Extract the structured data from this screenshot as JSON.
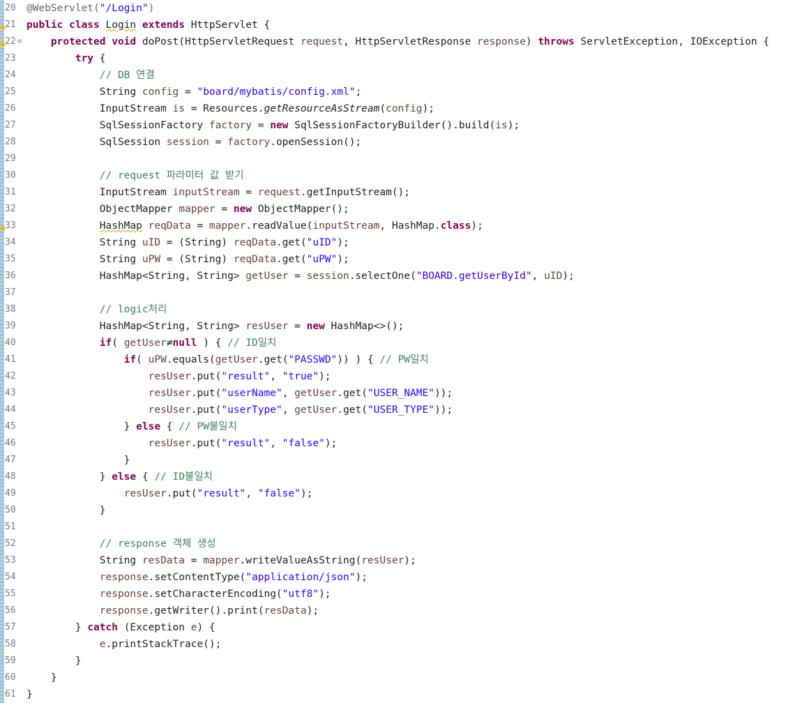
{
  "editor": {
    "lines": [
      {
        "num": "20",
        "tokens": [
          {
            "t": "@WebServlet(",
            "c": "ann"
          },
          {
            "t": "\"/Login\"",
            "c": "str"
          },
          {
            "t": ")",
            "c": "ann"
          }
        ]
      },
      {
        "num": "21",
        "marker": "warning",
        "tokens": [
          {
            "t": "public class ",
            "c": "kw"
          },
          {
            "t": "Login",
            "c": "squig"
          },
          {
            "t": " "
          },
          {
            "t": "extends",
            "c": "kw"
          },
          {
            "t": " HttpServlet {"
          }
        ]
      },
      {
        "num": "22",
        "marker": "warning",
        "fold": "⊖",
        "tokens": [
          {
            "t": "    "
          },
          {
            "t": "protected void",
            "c": "kw"
          },
          {
            "t": " doPost(HttpServletRequest "
          },
          {
            "t": "request",
            "c": "fld"
          },
          {
            "t": ", HttpServletResponse "
          },
          {
            "t": "response",
            "c": "fld"
          },
          {
            "t": ") "
          },
          {
            "t": "throws",
            "c": "kw"
          },
          {
            "t": " ServletException, IOException {"
          }
        ]
      },
      {
        "num": "23",
        "tokens": [
          {
            "t": "        "
          },
          {
            "t": "try",
            "c": "kw"
          },
          {
            "t": " {"
          }
        ]
      },
      {
        "num": "24",
        "tokens": [
          {
            "t": "            "
          },
          {
            "t": "// DB 연결",
            "c": "cm"
          }
        ]
      },
      {
        "num": "25",
        "tokens": [
          {
            "t": "            String "
          },
          {
            "t": "config",
            "c": "fld"
          },
          {
            "t": " = "
          },
          {
            "t": "\"board/mybatis/config.xml\"",
            "c": "str"
          },
          {
            "t": ";"
          }
        ]
      },
      {
        "num": "26",
        "tokens": [
          {
            "t": "            InputStream "
          },
          {
            "t": "is",
            "c": "fld"
          },
          {
            "t": " = Resources."
          },
          {
            "t": "getResourceAsStream",
            "c": "st"
          },
          {
            "t": "("
          },
          {
            "t": "config",
            "c": "fld"
          },
          {
            "t": ");"
          }
        ]
      },
      {
        "num": "27",
        "tokens": [
          {
            "t": "            SqlSessionFactory "
          },
          {
            "t": "factory",
            "c": "fld"
          },
          {
            "t": " = "
          },
          {
            "t": "new",
            "c": "kw"
          },
          {
            "t": " SqlSessionFactoryBuilder().build("
          },
          {
            "t": "is",
            "c": "fld"
          },
          {
            "t": ");"
          }
        ]
      },
      {
        "num": "28",
        "tokens": [
          {
            "t": "            SqlSession "
          },
          {
            "t": "session",
            "c": "fld"
          },
          {
            "t": " = "
          },
          {
            "t": "factory",
            "c": "fld"
          },
          {
            "t": ".openSession();"
          }
        ]
      },
      {
        "num": "29",
        "tokens": []
      },
      {
        "num": "30",
        "tokens": [
          {
            "t": "            "
          },
          {
            "t": "// request 파라미터 값 받기",
            "c": "cm"
          }
        ]
      },
      {
        "num": "31",
        "tokens": [
          {
            "t": "            InputStream "
          },
          {
            "t": "inputStream",
            "c": "fld"
          },
          {
            "t": " = "
          },
          {
            "t": "request",
            "c": "fld"
          },
          {
            "t": ".getInputStream();"
          }
        ]
      },
      {
        "num": "32",
        "tokens": [
          {
            "t": "            ObjectMapper "
          },
          {
            "t": "mapper",
            "c": "fld"
          },
          {
            "t": " = "
          },
          {
            "t": "new",
            "c": "kw"
          },
          {
            "t": " ObjectMapper();"
          }
        ]
      },
      {
        "num": "33",
        "marker": "warning",
        "tokens": [
          {
            "t": "            "
          },
          {
            "t": "HashMap",
            "c": "squig"
          },
          {
            "t": " "
          },
          {
            "t": "reqData",
            "c": "fld"
          },
          {
            "t": " = "
          },
          {
            "t": "mapper",
            "c": "fld"
          },
          {
            "t": ".readValue("
          },
          {
            "t": "inputStream",
            "c": "fld"
          },
          {
            "t": ", HashMap."
          },
          {
            "t": "class",
            "c": "kw"
          },
          {
            "t": ");"
          }
        ]
      },
      {
        "num": "34",
        "tokens": [
          {
            "t": "            String "
          },
          {
            "t": "uID",
            "c": "fld"
          },
          {
            "t": " = (String) "
          },
          {
            "t": "reqData",
            "c": "fld"
          },
          {
            "t": ".get("
          },
          {
            "t": "\"uID\"",
            "c": "str"
          },
          {
            "t": ");"
          }
        ]
      },
      {
        "num": "35",
        "tokens": [
          {
            "t": "            String "
          },
          {
            "t": "uPW",
            "c": "fld"
          },
          {
            "t": " = (String) "
          },
          {
            "t": "reqData",
            "c": "fld"
          },
          {
            "t": ".get("
          },
          {
            "t": "\"uPW\"",
            "c": "str"
          },
          {
            "t": ");"
          }
        ]
      },
      {
        "num": "36",
        "tokens": [
          {
            "t": "            HashMap<String, String> "
          },
          {
            "t": "getUser",
            "c": "fld"
          },
          {
            "t": " = "
          },
          {
            "t": "session",
            "c": "fld"
          },
          {
            "t": ".selectOne("
          },
          {
            "t": "\"BOARD.getUserById\"",
            "c": "str"
          },
          {
            "t": ", "
          },
          {
            "t": "uID",
            "c": "fld"
          },
          {
            "t": ");"
          }
        ]
      },
      {
        "num": "37",
        "tokens": []
      },
      {
        "num": "38",
        "tokens": [
          {
            "t": "            "
          },
          {
            "t": "// logic처리",
            "c": "cm"
          }
        ]
      },
      {
        "num": "39",
        "tokens": [
          {
            "t": "            HashMap<String, String> "
          },
          {
            "t": "resUser",
            "c": "fld"
          },
          {
            "t": " = "
          },
          {
            "t": "new",
            "c": "kw"
          },
          {
            "t": " HashMap<>();"
          }
        ]
      },
      {
        "num": "40",
        "tokens": [
          {
            "t": "            "
          },
          {
            "t": "if",
            "c": "kw"
          },
          {
            "t": "( "
          },
          {
            "t": "getUser",
            "c": "fld"
          },
          {
            "t": "≠"
          },
          {
            "t": "null",
            "c": "kw"
          },
          {
            "t": " ) { "
          },
          {
            "t": "// ID일치",
            "c": "cm"
          }
        ]
      },
      {
        "num": "41",
        "tokens": [
          {
            "t": "                "
          },
          {
            "t": "if",
            "c": "kw"
          },
          {
            "t": "( "
          },
          {
            "t": "uPW",
            "c": "fld"
          },
          {
            "t": ".equals("
          },
          {
            "t": "getUser",
            "c": "fld"
          },
          {
            "t": ".get("
          },
          {
            "t": "\"PASSWD\"",
            "c": "str"
          },
          {
            "t": ")) ) { "
          },
          {
            "t": "// PW일치",
            "c": "cm"
          }
        ]
      },
      {
        "num": "42",
        "tokens": [
          {
            "t": "                    "
          },
          {
            "t": "resUser",
            "c": "fld"
          },
          {
            "t": ".put("
          },
          {
            "t": "\"result\"",
            "c": "str"
          },
          {
            "t": ", "
          },
          {
            "t": "\"true\"",
            "c": "str"
          },
          {
            "t": ");"
          }
        ]
      },
      {
        "num": "43",
        "tokens": [
          {
            "t": "                    "
          },
          {
            "t": "resUser",
            "c": "fld"
          },
          {
            "t": ".put("
          },
          {
            "t": "\"userName\"",
            "c": "str"
          },
          {
            "t": ", "
          },
          {
            "t": "getUser",
            "c": "fld"
          },
          {
            "t": ".get("
          },
          {
            "t": "\"USER_NAME\"",
            "c": "str"
          },
          {
            "t": "));"
          }
        ]
      },
      {
        "num": "44",
        "tokens": [
          {
            "t": "                    "
          },
          {
            "t": "resUser",
            "c": "fld"
          },
          {
            "t": ".put("
          },
          {
            "t": "\"userType\"",
            "c": "str"
          },
          {
            "t": ", "
          },
          {
            "t": "getUser",
            "c": "fld"
          },
          {
            "t": ".get("
          },
          {
            "t": "\"USER_TYPE\"",
            "c": "str"
          },
          {
            "t": "));"
          }
        ]
      },
      {
        "num": "45",
        "tokens": [
          {
            "t": "                } "
          },
          {
            "t": "else",
            "c": "kw"
          },
          {
            "t": " { "
          },
          {
            "t": "// PW불일치",
            "c": "cm"
          }
        ]
      },
      {
        "num": "46",
        "tokens": [
          {
            "t": "                    "
          },
          {
            "t": "resUser",
            "c": "fld"
          },
          {
            "t": ".put("
          },
          {
            "t": "\"result\"",
            "c": "str"
          },
          {
            "t": ", "
          },
          {
            "t": "\"false\"",
            "c": "str"
          },
          {
            "t": ");"
          }
        ]
      },
      {
        "num": "47",
        "tokens": [
          {
            "t": "                }"
          }
        ]
      },
      {
        "num": "48",
        "tokens": [
          {
            "t": "            } "
          },
          {
            "t": "else",
            "c": "kw"
          },
          {
            "t": " { "
          },
          {
            "t": "// ID불일치",
            "c": "cm"
          }
        ]
      },
      {
        "num": "49",
        "tokens": [
          {
            "t": "                "
          },
          {
            "t": "resUser",
            "c": "fld"
          },
          {
            "t": ".put("
          },
          {
            "t": "\"result\"",
            "c": "str"
          },
          {
            "t": ", "
          },
          {
            "t": "\"false\"",
            "c": "str"
          },
          {
            "t": ");"
          }
        ]
      },
      {
        "num": "50",
        "tokens": [
          {
            "t": "            }"
          }
        ]
      },
      {
        "num": "51",
        "tokens": []
      },
      {
        "num": "52",
        "tokens": [
          {
            "t": "            "
          },
          {
            "t": "// response 객체 생성",
            "c": "cm"
          }
        ]
      },
      {
        "num": "53",
        "tokens": [
          {
            "t": "            String "
          },
          {
            "t": "resData",
            "c": "fld"
          },
          {
            "t": " = "
          },
          {
            "t": "mapper",
            "c": "fld"
          },
          {
            "t": ".writeValueAsString("
          },
          {
            "t": "resUser",
            "c": "fld"
          },
          {
            "t": ");"
          }
        ]
      },
      {
        "num": "54",
        "tokens": [
          {
            "t": "            "
          },
          {
            "t": "response",
            "c": "fld"
          },
          {
            "t": ".setContentType("
          },
          {
            "t": "\"application/json\"",
            "c": "str"
          },
          {
            "t": ");"
          }
        ]
      },
      {
        "num": "55",
        "tokens": [
          {
            "t": "            "
          },
          {
            "t": "response",
            "c": "fld"
          },
          {
            "t": ".setCharacterEncoding("
          },
          {
            "t": "\"utf8\"",
            "c": "str"
          },
          {
            "t": ");"
          }
        ]
      },
      {
        "num": "56",
        "tokens": [
          {
            "t": "            "
          },
          {
            "t": "response",
            "c": "fld"
          },
          {
            "t": ".getWriter().print("
          },
          {
            "t": "resData",
            "c": "fld"
          },
          {
            "t": ");"
          }
        ]
      },
      {
        "num": "57",
        "tokens": [
          {
            "t": "        } "
          },
          {
            "t": "catch",
            "c": "kw"
          },
          {
            "t": " (Exception "
          },
          {
            "t": "e",
            "c": "fld"
          },
          {
            "t": ") {"
          }
        ]
      },
      {
        "num": "58",
        "tokens": [
          {
            "t": "            "
          },
          {
            "t": "e",
            "c": "fld"
          },
          {
            "t": ".printStackTrace();"
          }
        ]
      },
      {
        "num": "59",
        "tokens": [
          {
            "t": "        }"
          }
        ]
      },
      {
        "num": "60",
        "tokens": [
          {
            "t": "    }"
          }
        ]
      },
      {
        "num": "61",
        "tokens": [
          {
            "t": "}"
          }
        ]
      }
    ]
  }
}
